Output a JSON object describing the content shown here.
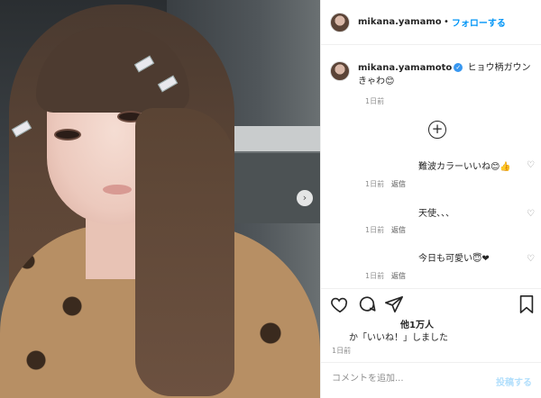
{
  "post": {
    "username": "mikana.yamamoto",
    "follow_separator": "•",
    "follow_label": "フォローする",
    "verified_icon": "✓",
    "caption_username": "mikana.yamamoto",
    "caption_text": "ヒョウ柄ガウンきゃわ😊",
    "caption_time": "1日前",
    "load_more_icon": "+"
  },
  "comments": [
    {
      "text": "難波カラーいいね😊👍",
      "time": "1日前",
      "reply": "返信"
    },
    {
      "text": "天使、、、",
      "time": "1日前",
      "reply": "返信"
    },
    {
      "text": "今日も可愛い😇❤",
      "time": "1日前",
      "reply": "返信"
    }
  ],
  "engagement": {
    "likes_text": "他1万人",
    "liked_by_text": "か「いいね！」しました",
    "post_time": "1日前"
  },
  "composer": {
    "placeholder": "コメントを追加...",
    "post_label": "投稿する"
  },
  "icons": {
    "next": "›",
    "heart": "♡"
  },
  "colors": {
    "link_blue": "#0095f6",
    "post_disabled": "#b2dffc",
    "verified": "#3897f0"
  }
}
